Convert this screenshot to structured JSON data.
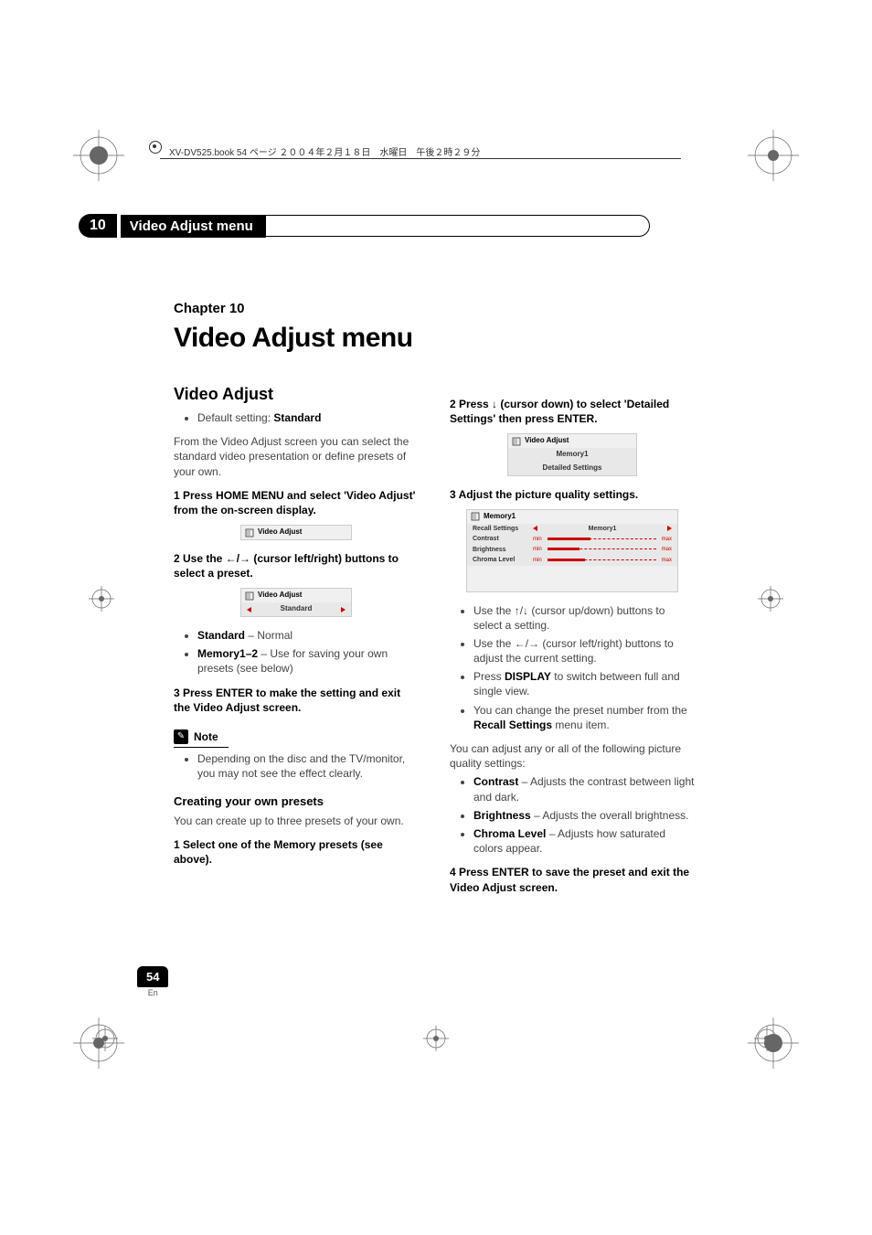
{
  "header": {
    "text": "XV-DV525.book  54 ページ  ２００４年２月１８日　水曜日　午後２時２９分"
  },
  "tab": {
    "number": "10",
    "label": "Video Adjust menu"
  },
  "chapter": {
    "label": "Chapter 10",
    "title": "Video Adjust menu"
  },
  "left": {
    "heading": "Video Adjust",
    "default_prefix": "Default setting: ",
    "default_value": "Standard",
    "intro": "From the Video Adjust screen you can select the standard video presentation or define presets of your own.",
    "step1": "1    Press HOME MENU and select 'Video Adjust' from the on-screen display.",
    "panel1_title": "Video Adjust",
    "step2": "2    Use the ←/→ (cursor left/right) buttons to select a preset.",
    "panel2_title": "Video Adjust",
    "panel2_value": "Standard",
    "li_std_b": "Standard",
    "li_std_t": "  – Normal",
    "li_mem_b": "Memory1–2",
    "li_mem_t": " – Use for saving your own presets (see below)",
    "step3": "3    Press ENTER to make the setting and exit the Video Adjust screen.",
    "note_label": "Note",
    "note_text": "Depending on the disc and the TV/monitor, you may not see the effect clearly.",
    "sub_heading": "Creating your own presets",
    "sub_intro": "You can create up to three presets of your own.",
    "sub_step1": "1    Select one of the Memory presets (see above)."
  },
  "right": {
    "step2": "2    Press ↓ (cursor down) to select 'Detailed Settings' then press ENTER.",
    "panelA_title": "Video Adjust",
    "panelA_row1": "Memory1",
    "panelA_row2": "Detailed Settings",
    "step3": "3    Adjust the picture quality settings.",
    "panelB_title": "Memory1",
    "panelB_recall": "Recall Settings",
    "panelB_recall_val": "Memory1",
    "panelB_contrast": "Contrast",
    "panelB_brightness": "Brightness",
    "panelB_chroma": "Chroma Level",
    "panelB_min": "min",
    "panelB_max": "max",
    "li1": "Use the ↑/↓ (cursor up/down) buttons to select a setting.",
    "li2": "Use the ←/→ (cursor left/right) buttons to adjust the current setting.",
    "li3a": "Press ",
    "li3b": "DISPLAY",
    "li3c": " to switch between full and single view.",
    "li4a": "You can change the preset number from the ",
    "li4b": "Recall Settings",
    "li4c": " menu item.",
    "body": "You can adjust any or all of the following picture quality settings:",
    "q1b": "Contrast",
    "q1t": " – Adjusts the contrast between light and dark.",
    "q2b": "Brightness",
    "q2t": " – Adjusts the overall brightness.",
    "q3b": "Chroma Level",
    "q3t": " – Adjusts how saturated colors appear.",
    "step4": "4    Press ENTER to save the preset and exit the Video Adjust screen."
  },
  "page_number": {
    "num": "54",
    "lang": "En"
  }
}
